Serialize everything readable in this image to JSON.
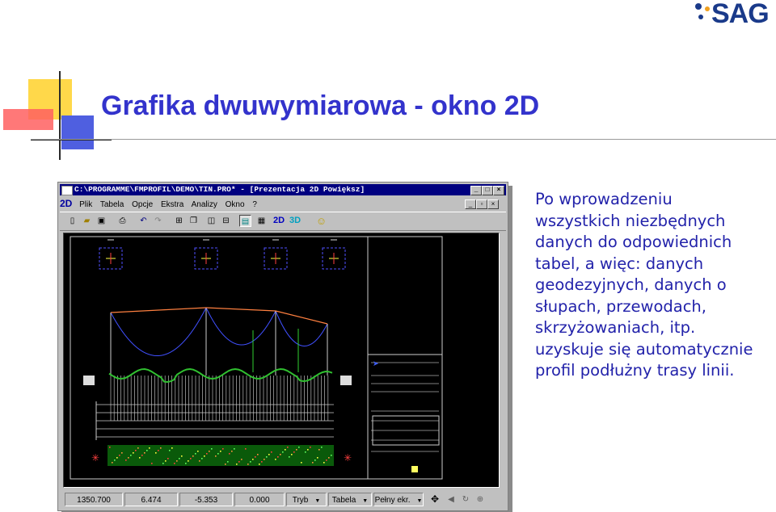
{
  "slide": {
    "title": "Grafika dwuwymiarowa - okno 2D",
    "logo_text": "SAG",
    "description_lines": [
      "Po wprowadzeniu",
      "wszystkich niezbędnych",
      "danych do odpowiednich",
      "tabel, a więc: danych",
      "geodezyjnych, danych o",
      "słupach, przewodach,",
      "skrzyżowaniach, itp.",
      "uzyskuje się automatycznie",
      "profil podłużny trasy linii."
    ],
    "colors": {
      "title": "#3333cc",
      "description": "#2222aa",
      "logo": "#1a3a8a",
      "logo_dot": "#f0a020"
    }
  },
  "window": {
    "title": "C:\\PROGRAMME\\FMPROFIL\\DEMO\\TIN.PRO* - [Prezentacja 2D Powiększ]",
    "menu_logo": "2D",
    "menu": [
      "Plik",
      "Tabela",
      "Opcje",
      "Ekstra",
      "Analizy",
      "Okno",
      "?"
    ],
    "toolbar_labels": {
      "view_2d": "2D",
      "view_3d": "3D"
    },
    "status": {
      "coord_x": "1350.700",
      "coord_y": "6.474",
      "coord_z": "-5.353",
      "value": "0.000",
      "mode": "Tryb",
      "table": "Tabela",
      "fullscreen": "Pełny ekr."
    }
  }
}
